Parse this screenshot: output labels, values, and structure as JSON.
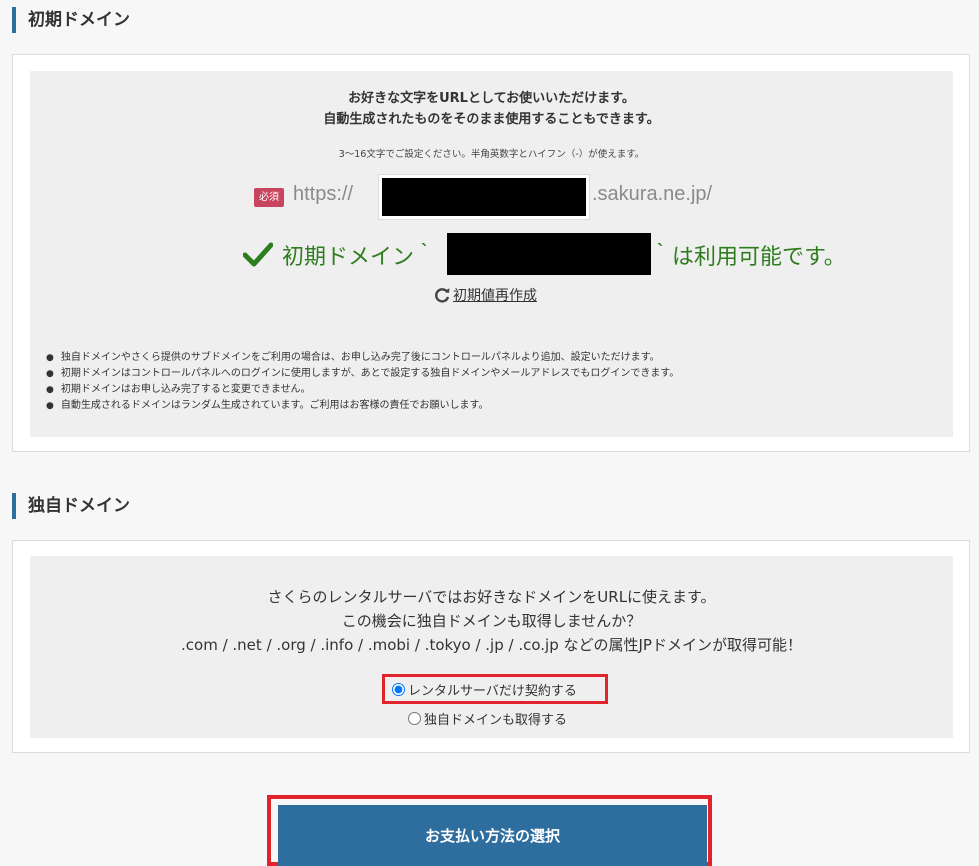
{
  "initial_domain": {
    "heading": "初期ドメイン",
    "intro_line1": "お好きな文字をURLとしてお使いいただけます。",
    "intro_line2": "自動生成されたものをそのまま使用することもできます。",
    "hint": "3～16文字でご設定ください。半角英数字とハイフン（-）が使えます。",
    "required_badge": "必須",
    "url_prefix": "https://",
    "url_suffix": ".sakura.ne.jp/",
    "availability_prefix": "初期ドメイン｀",
    "availability_suffix": "｀は利用可能です。",
    "regenerate_label": "初期値再作成",
    "notes": [
      "独自ドメインやさくら提供のサブドメインをご利用の場合は、お申し込み完了後にコントロールパネルより追加、設定いただけます。",
      "初期ドメインはコントロールパネルへのログインに使用しますが、あとで設定する独自ドメインやメールアドレスでもログインできます。",
      "初期ドメインはお申し込み完了すると変更できません。",
      "自動生成されるドメインはランダム生成されています。ご利用はお客様の責任でお願いします。"
    ]
  },
  "own_domain": {
    "heading": "独自ドメイン",
    "text_line1": "さくらのレンタルサーバではお好きなドメインをURLに使えます。",
    "text_line2": "この機会に独自ドメインも取得しませんか？",
    "text_line3": ".com / .net / .org / .info / .mobi / .tokyo / .jp / .co.jp などの属性JPドメインが取得可能！",
    "options": [
      {
        "label": "レンタルサーバだけ契約する",
        "selected": true
      },
      {
        "label": "独自ドメインも取得する",
        "selected": false
      }
    ]
  },
  "submit_label": "お支払い方法の選択",
  "colors": {
    "accent": "#2e6e9e",
    "success": "#2e7d1f",
    "required_badge": "#c9455f",
    "highlight": "#e0232d"
  }
}
